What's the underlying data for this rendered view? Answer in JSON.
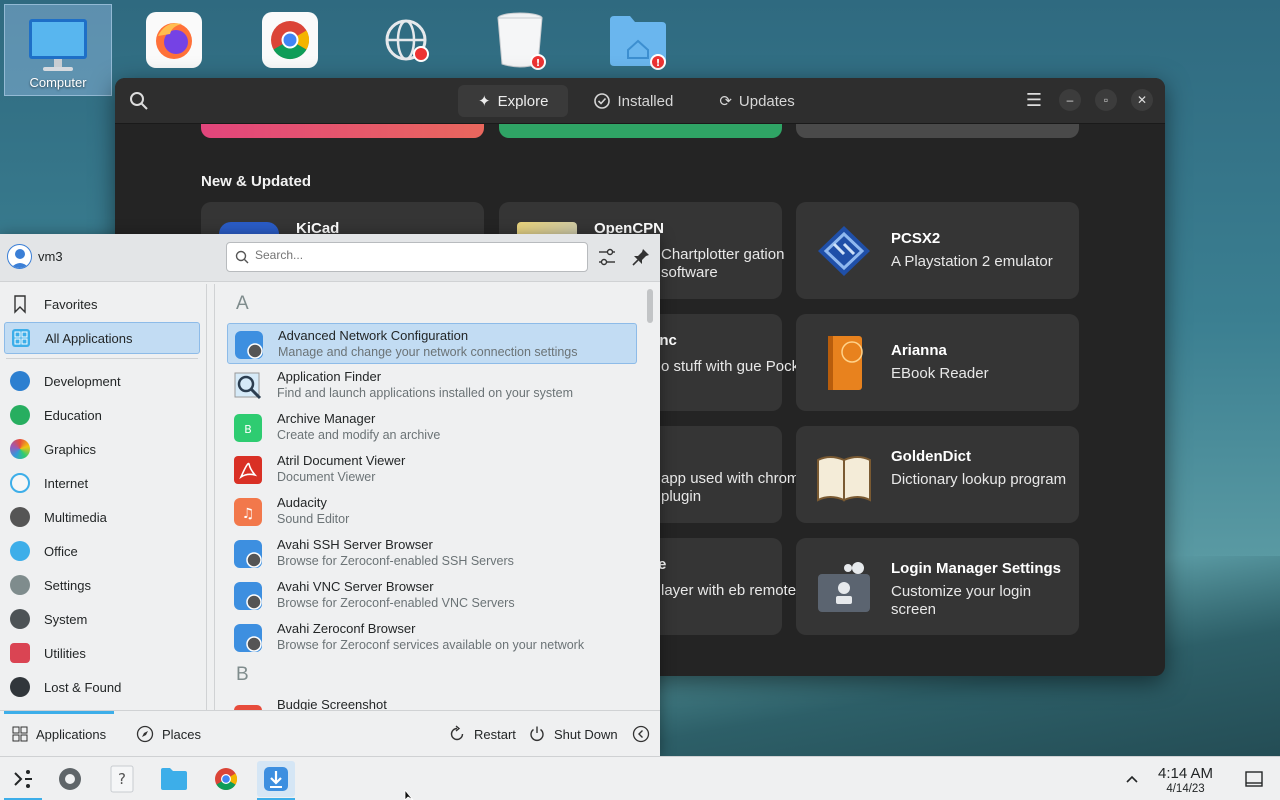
{
  "desktop": {
    "computer_label": "Computer",
    "icons": [
      "computer-icon",
      "firefox-icon",
      "chrome-icon",
      "network-icon",
      "trash-icon",
      "home-folder-icon"
    ]
  },
  "software": {
    "tabs": [
      {
        "label": "Explore",
        "icon": "star-icon",
        "active": true
      },
      {
        "label": "Installed",
        "icon": "check-icon",
        "active": false
      },
      {
        "label": "Updates",
        "icon": "refresh-icon",
        "active": false
      }
    ],
    "section_title": "New & Updated",
    "cards": [
      {
        "name": "KiCad",
        "desc": ""
      },
      {
        "name": "OpenCPN",
        "desc": "Chartplotter gation software"
      },
      {
        "name": "PCSX2",
        "desc": "A Playstation 2 emulator"
      },
      {
        "name": "ync",
        "desc": "o stuff with gue Pocket."
      },
      {
        "name": "Arianna",
        "desc": "EBook Reader"
      },
      {
        "name": "",
        "desc": "app used with chrome plugin"
      },
      {
        "name": "GoldenDict",
        "desc": "Dictionary lookup program"
      },
      {
        "name": "e",
        "desc": "layer with eb remote cli…"
      },
      {
        "name": "Login Manager Settings",
        "desc": "Customize your login screen"
      }
    ],
    "banner_colors": [
      "#e2457c",
      "#2fa465",
      "#4a4a4a"
    ]
  },
  "launcher": {
    "user": "vm3",
    "search_placeholder": "Search...",
    "categories": [
      {
        "label": "Favorites",
        "icon": "bookmark-icon",
        "active": false
      },
      {
        "label": "All Applications",
        "icon": "grid-icon",
        "active": true
      },
      {
        "label": "Development",
        "icon": "development-icon",
        "active": false
      },
      {
        "label": "Education",
        "icon": "education-icon",
        "active": false
      },
      {
        "label": "Graphics",
        "icon": "graphics-icon",
        "active": false
      },
      {
        "label": "Internet",
        "icon": "internet-icon",
        "active": false
      },
      {
        "label": "Multimedia",
        "icon": "multimedia-icon",
        "active": false
      },
      {
        "label": "Office",
        "icon": "office-icon",
        "active": false
      },
      {
        "label": "Settings",
        "icon": "settings-icon",
        "active": false
      },
      {
        "label": "System",
        "icon": "system-icon",
        "active": false
      },
      {
        "label": "Utilities",
        "icon": "utilities-icon",
        "active": false
      },
      {
        "label": "Lost & Found",
        "icon": "lost-found-icon",
        "active": false
      }
    ],
    "letter_a": "A",
    "letter_b": "B",
    "apps": [
      {
        "name": "Advanced Network Configuration",
        "desc": "Manage and change your network connection settings",
        "active": true
      },
      {
        "name": "Application Finder",
        "desc": "Find and launch applications installed on your system",
        "active": false
      },
      {
        "name": "Archive Manager",
        "desc": "Create and modify an archive",
        "active": false
      },
      {
        "name": "Atril Document Viewer",
        "desc": "Document Viewer",
        "active": false
      },
      {
        "name": "Audacity",
        "desc": "Sound Editor",
        "active": false
      },
      {
        "name": "Avahi SSH Server Browser",
        "desc": "Browse for Zeroconf-enabled SSH Servers",
        "active": false
      },
      {
        "name": "Avahi VNC Server Browser",
        "desc": "Browse for Zeroconf-enabled VNC Servers",
        "active": false
      },
      {
        "name": "Avahi Zeroconf Browser",
        "desc": "Browse for Zeroconf services available on your network",
        "active": false
      }
    ],
    "partial_app": "Budgie Screenshot",
    "bottom": {
      "applications": "Applications",
      "places": "Places",
      "restart": "Restart",
      "shutdown": "Shut Down"
    }
  },
  "taskbar": {
    "time": "4:14 AM",
    "date": "4/14/23"
  },
  "colors": {
    "accent": "#3daee9",
    "selection": "#c2dcf3"
  }
}
